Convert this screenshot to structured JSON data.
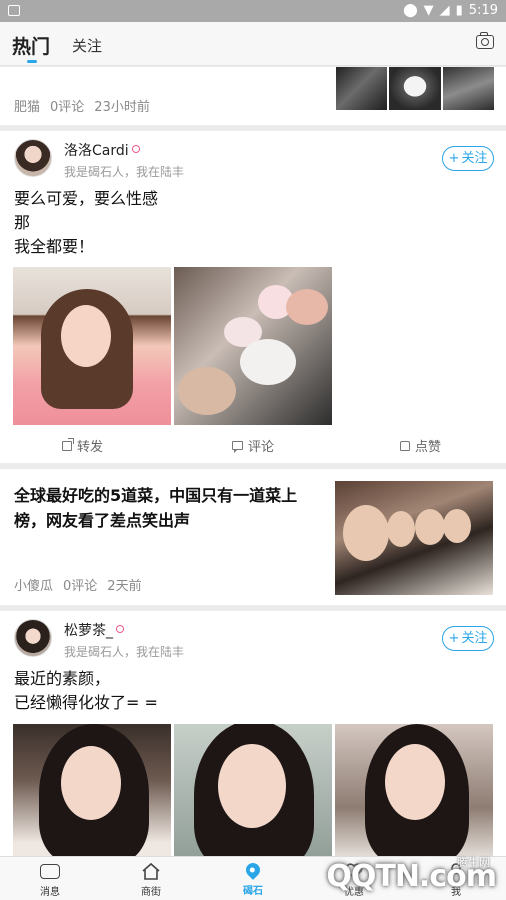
{
  "status_bar": {
    "time": "5:19"
  },
  "header": {
    "tabs": [
      {
        "label": "热门",
        "active": true
      },
      {
        "label": "关注",
        "active": false
      }
    ]
  },
  "feed": {
    "item1": {
      "author": "肥猫",
      "comments": "0评论",
      "time": "23小时前"
    },
    "item2": {
      "username": "洛洛Cardi",
      "subline": "我是碣石人，我在陆丰",
      "follow": "关注",
      "text": [
        "要么可爱，要么性感",
        "那",
        "我全都要！"
      ],
      "actions": {
        "share": "转发",
        "comment": "评论",
        "like": "点赞"
      }
    },
    "item3": {
      "title": "全球最好吃的5道菜，中国只有一道菜上榜，网友看了差点笑出声",
      "author": "小傻瓜",
      "comments": "0评论",
      "time": "2天前"
    },
    "item4": {
      "username": "松萝茶_",
      "subline": "我是碣石人，我在陆丰",
      "follow": "关注",
      "text": [
        "最近的素颜，",
        "已经懒得化妆了= ="
      ]
    }
  },
  "bottom_nav": [
    {
      "label": "消息",
      "icon": "message-icon"
    },
    {
      "label": "商街",
      "icon": "shop-icon"
    },
    {
      "label": "碣石",
      "icon": "location-pin-icon",
      "active": true
    },
    {
      "label": "优惠",
      "icon": "heart-icon"
    },
    {
      "label": "我",
      "icon": "user-icon"
    }
  ],
  "watermark": {
    "brand": "QQTN.com",
    "sub": "腾牛网"
  },
  "colors": {
    "accent": "#2aa6e8",
    "female": "#f05a8a"
  }
}
